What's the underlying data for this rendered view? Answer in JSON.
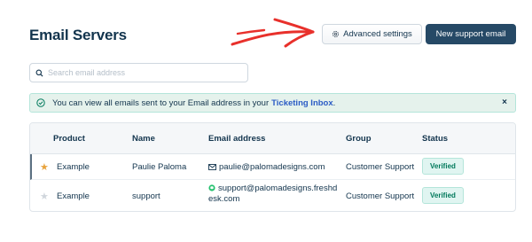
{
  "header": {
    "title": "Email Servers",
    "advanced_settings_label": "Advanced settings",
    "new_support_email_label": "New support email"
  },
  "search": {
    "placeholder": "Search email address"
  },
  "banner": {
    "text": "You can view all emails sent to your Email address in your",
    "link": "Ticketing Inbox",
    "suffix": ".",
    "close": "×"
  },
  "table": {
    "columns": {
      "product": "Product",
      "name": "Name",
      "email": "Email address",
      "group": "Group",
      "status": "Status"
    },
    "rows": [
      {
        "starred": true,
        "product": "Example",
        "name": "Paulie Paloma",
        "email": "paulie@palomadesigns.com",
        "email_line2": "",
        "group": "Customer Support",
        "status": "Verified"
      },
      {
        "starred": false,
        "product": "Example",
        "name": "support",
        "email": "support@palomadesigns.freshd",
        "email_line2": "esk.com",
        "group": "Customer Support",
        "status": "Verified"
      }
    ]
  },
  "colors": {
    "primary": "#264966",
    "annotation_arrow": "#e8302b",
    "star_active": "#e8a33d",
    "verified": "#00795b"
  },
  "icons": [
    "gear-icon",
    "search-icon",
    "check-circle-icon",
    "close-icon",
    "star-icon",
    "envelope-icon",
    "freshdesk-icon",
    "arrow-annotation"
  ]
}
